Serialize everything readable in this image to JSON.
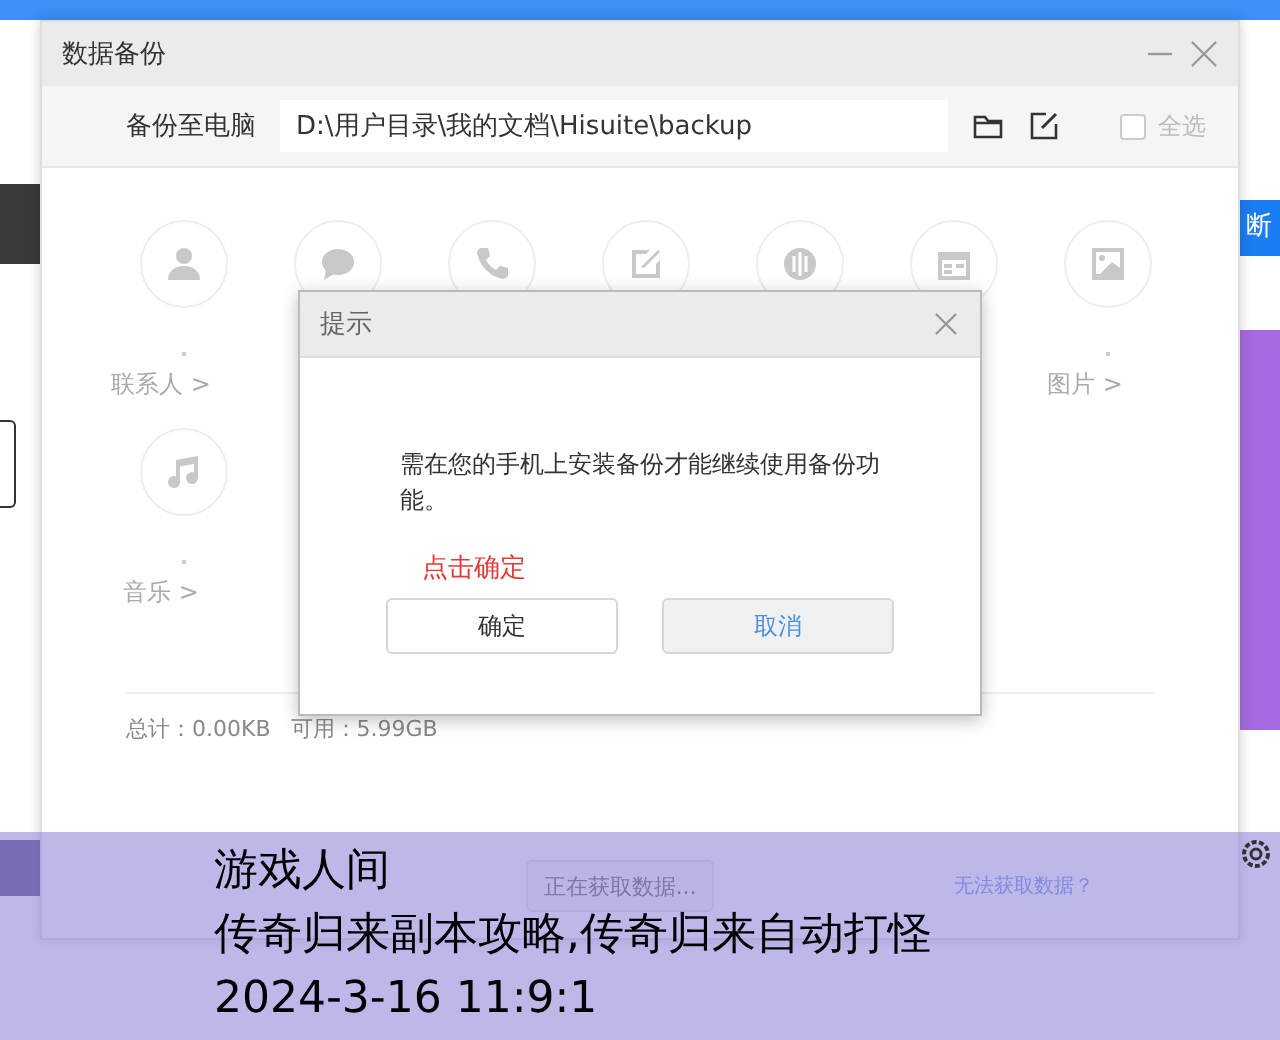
{
  "background_app": {
    "disconnect_button": "断"
  },
  "window": {
    "title": "数据备份",
    "path_row": {
      "label": "备份至电脑",
      "value": "D:\\用户目录\\我的文档\\Hisuite\\backup",
      "select_all": {
        "label": "全选",
        "checked": false
      }
    },
    "categories": [
      {
        "kind": "person",
        "label": "联系人 >"
      },
      {
        "kind": "chat"
      },
      {
        "kind": "phone"
      },
      {
        "kind": "edit"
      },
      {
        "kind": "wave"
      },
      {
        "kind": "calendar"
      },
      {
        "kind": "image",
        "label": "图片 >"
      },
      {
        "kind": "music",
        "label": "音乐 >"
      }
    ],
    "footer": {
      "total": "总计：0.00KB",
      "available": "可用：5.99GB"
    },
    "fetch_button": "正在获取数据...",
    "help_link": "无法获取数据？"
  },
  "dialog": {
    "title": "提示",
    "message": "需在您的手机上安装备份才能继续使用备份功能。",
    "hint": "点击确定",
    "buttons": [
      {
        "label": "确定",
        "kind": "primary"
      },
      {
        "label": "取消",
        "kind": "secondary"
      }
    ]
  },
  "caption": {
    "lines": [
      "游戏人间",
      "传奇归来副本攻略,传奇归来自动打怪",
      "2024-3-16 11:9:1"
    ]
  }
}
